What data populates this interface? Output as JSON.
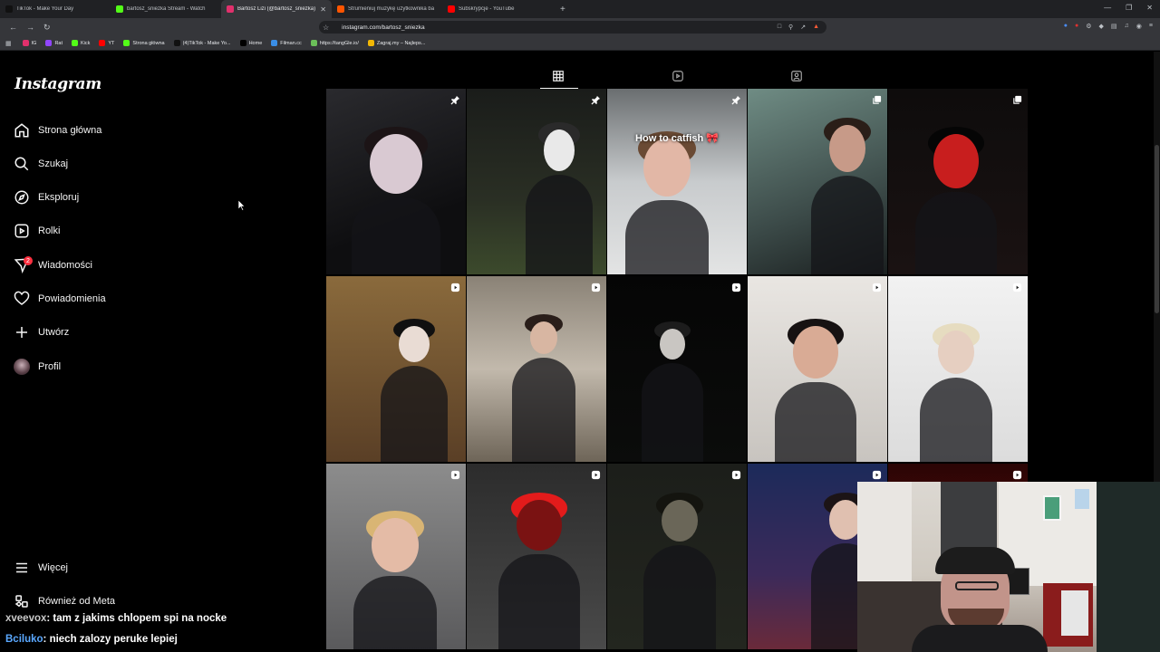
{
  "browser": {
    "tabs": [
      {
        "title": "TikTok - Make Your Day",
        "color": "#111111",
        "active": false
      },
      {
        "title": "bartosz_sniezka Stream - Watch",
        "color": "#53fc18",
        "active": false
      },
      {
        "title": "Bartosz Lizi (@bartosz_sniezka) ·",
        "color": "#e1306c",
        "active": true
      },
      {
        "title": "Strumieniuj muzykę użytkownika ba",
        "color": "#ff5500",
        "active": false
      },
      {
        "title": "Subskrypcje - YouTube",
        "color": "#ff0000",
        "active": false
      }
    ],
    "new_tab": "+",
    "url": "instagram.com/bartosz_sniezka",
    "bookmarks": [
      {
        "label": "IG",
        "color": "#e1306c"
      },
      {
        "label": "Rat",
        "color": "#9146ff"
      },
      {
        "label": "Kick",
        "color": "#53fc18"
      },
      {
        "label": "YT",
        "color": "#ff0000"
      },
      {
        "label": "Strona główna",
        "color": "#53fc18"
      },
      {
        "label": "(4)TikTok - Make Yo...",
        "color": "#111111"
      },
      {
        "label": "Home",
        "color": "#000000"
      },
      {
        "label": "Filman.cc",
        "color": "#3a8ee6"
      },
      {
        "label": "https://tangGle.io/",
        "color": "#6bbf59"
      },
      {
        "label": "Zagraj.my – Najleps...",
        "color": "#f2b705"
      }
    ]
  },
  "instagram": {
    "logo": "Instagram",
    "nav": [
      {
        "label": "Strona główna",
        "icon": "home-icon"
      },
      {
        "label": "Szukaj",
        "icon": "search-icon"
      },
      {
        "label": "Eksploruj",
        "icon": "compass-icon"
      },
      {
        "label": "Rolki",
        "icon": "reels-icon"
      },
      {
        "label": "Wiadomości",
        "icon": "messenger-icon",
        "badge": "2"
      },
      {
        "label": "Powiadomienia",
        "icon": "heart-icon"
      },
      {
        "label": "Utwórz",
        "icon": "plus-icon"
      },
      {
        "label": "Profil",
        "icon": "avatar"
      }
    ],
    "more": {
      "label": "Więcej",
      "icon": "menu-icon"
    },
    "meta": {
      "label": "Również od Meta",
      "icon": "meta-icon"
    },
    "profile_tabs": [
      "grid-icon",
      "reels-tab-icon",
      "tagged-icon"
    ],
    "posts": [
      {
        "badge": "pin",
        "caption": ""
      },
      {
        "badge": "pin",
        "caption": ""
      },
      {
        "badge": "pin",
        "caption": "How to catfish 🎀"
      },
      {
        "badge": "carousel",
        "caption": ""
      },
      {
        "badge": "carousel",
        "caption": ""
      },
      {
        "badge": "reel",
        "caption": ""
      },
      {
        "badge": "reel",
        "caption": ""
      },
      {
        "badge": "reel",
        "caption": ""
      },
      {
        "badge": "reel",
        "caption": ""
      },
      {
        "badge": "reel",
        "caption": ""
      },
      {
        "badge": "reel",
        "caption": ""
      },
      {
        "badge": "reel",
        "caption": ""
      },
      {
        "badge": "reel",
        "caption": ""
      },
      {
        "badge": "reel",
        "caption": ""
      },
      {
        "badge": "reel",
        "caption": ""
      }
    ]
  },
  "chat": [
    {
      "user": "xveevox",
      "message": ": tam z jakims chlopem spi na nocke"
    },
    {
      "user": "Bciluko",
      "message": ": niech zalozy peruke lepiej"
    }
  ]
}
